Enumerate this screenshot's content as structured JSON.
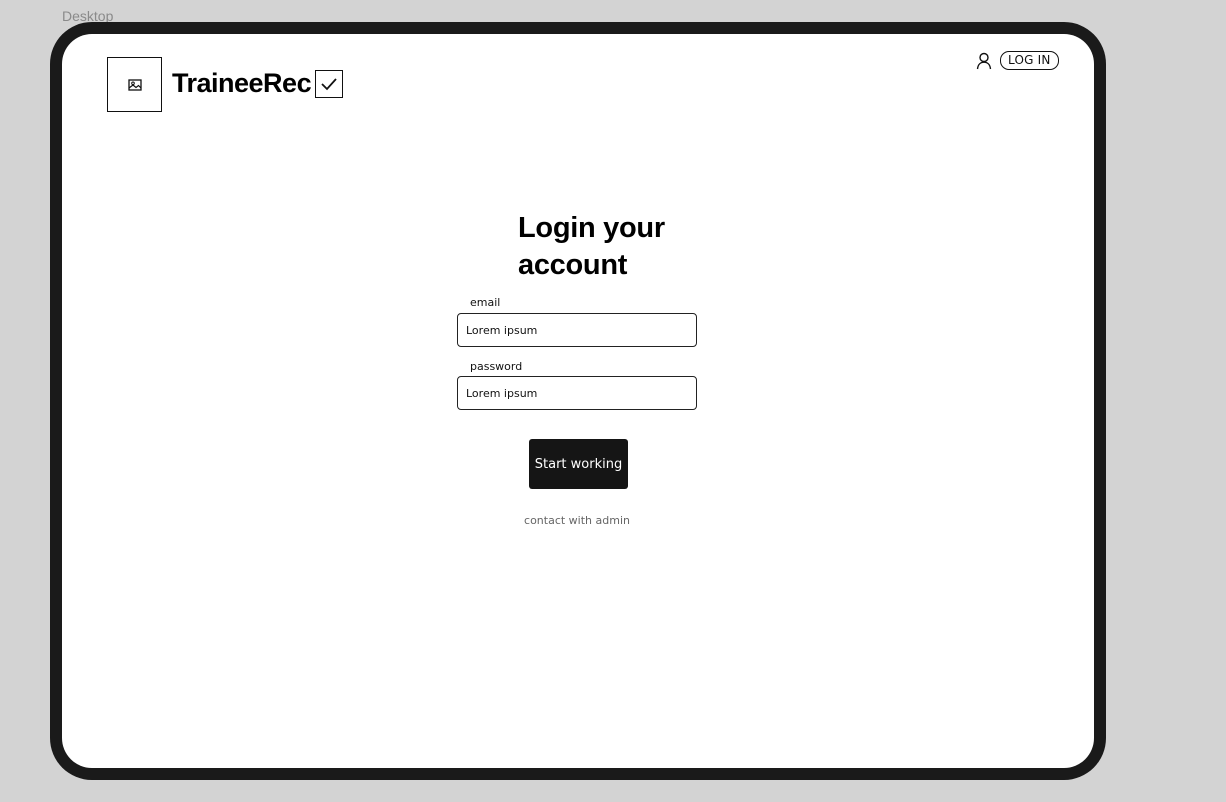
{
  "canvas": {
    "frame_label": "Desktop"
  },
  "header": {
    "brand_name": "TraineeRec",
    "login_label": "LOG IN"
  },
  "icons": {
    "logo": "image-placeholder-icon",
    "brand_check": "checkbox-checked-icon",
    "user": "user-icon"
  },
  "login_form": {
    "title_line1": "Login your",
    "title_line2": "account",
    "email": {
      "label": "email",
      "value": "Lorem ipsum"
    },
    "password": {
      "label": "password",
      "value": "Lorem ipsum"
    },
    "submit_label": "Start working",
    "contact_link": "contact with admin"
  },
  "colors": {
    "background": "#d3d3d3",
    "device_frame": "#1a1a1a",
    "screen": "#ffffff",
    "primary_button": "#151515",
    "muted_text": "#666666"
  }
}
